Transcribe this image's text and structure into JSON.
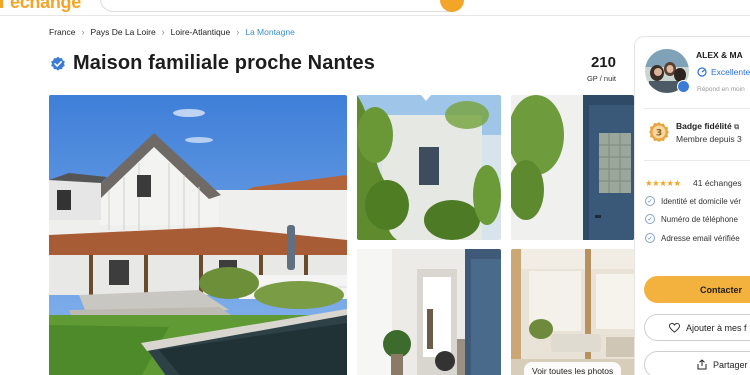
{
  "header": {
    "logo_text": "échange",
    "brand_color": "#f3a529"
  },
  "breadcrumb": {
    "items": [
      "France",
      "Pays De La Loire",
      "Loire-Atlantique"
    ],
    "current": "La Montagne",
    "separator": "›"
  },
  "listing": {
    "title": "Maison familiale proche Nantes",
    "price": "210",
    "price_unit": "GP / nuit",
    "see_all_photos": "Voir toutes les photos"
  },
  "host": {
    "name": "ALEX & MA",
    "level": "Excellente",
    "response": "Répond en moin",
    "badge_title": "Badge fidélité",
    "badge_sub": "Membre depuis 3",
    "stars": "★★★★★",
    "exchanges": "41 échanges",
    "verifications": [
      "Identité et domicile vér",
      "Numéro de téléphone",
      "Adresse email vérifiée"
    ]
  },
  "actions": {
    "contact": "Contacter",
    "favorite": "Ajouter à mes f",
    "share": "Partager"
  },
  "icons": {
    "verified": "verified-badge-icon",
    "heart": "heart-icon",
    "share": "share-icon",
    "check": "check-circle-icon"
  }
}
